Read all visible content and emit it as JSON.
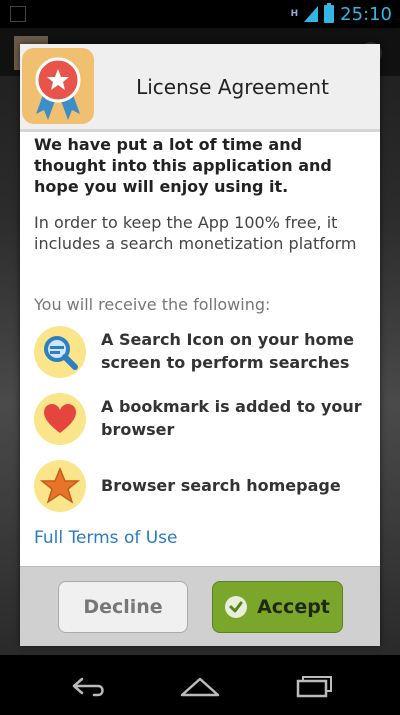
{
  "status_bar": {
    "network": "H",
    "time": "25:10"
  },
  "dialog": {
    "title": "License Agreement",
    "intro": "We have put a lot of time and thought into this application and hope you will enjoy using it.",
    "explanation": "In order to keep the App 100% free, it includes a search monetization platform",
    "receive_heading": "You will receive the following:",
    "features": [
      {
        "icon": "search-magnifier-icon",
        "text": "A Search Icon on your home screen to perform searches"
      },
      {
        "icon": "heart-icon",
        "text": "A bookmark is added to your browser"
      },
      {
        "icon": "star-icon",
        "text": "Browser search homepage"
      }
    ],
    "terms_link": "Full Terms of Use",
    "decline_label": "Decline",
    "accept_label": "Accept"
  },
  "nav_bar": {
    "buttons": [
      "back-icon",
      "home-icon",
      "recent-apps-icon"
    ]
  },
  "colors": {
    "accent": "#33b5e5",
    "accept": "#79a62b",
    "link": "#2a7ac0",
    "feature_circle": "#fbe58a"
  }
}
